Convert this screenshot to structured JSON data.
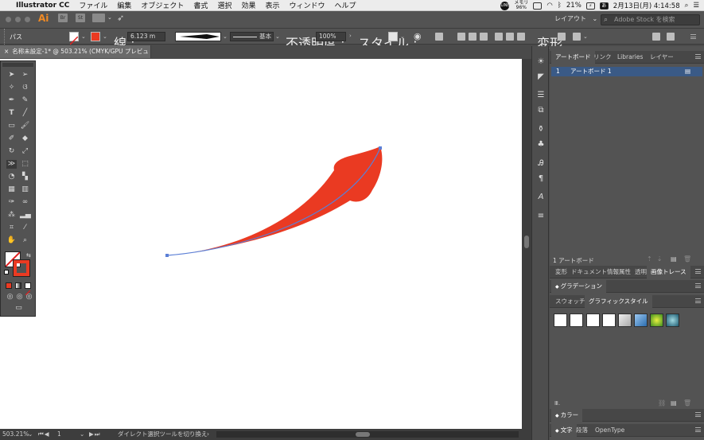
{
  "menubar": {
    "app_name": "Illustrator CC",
    "items": [
      "ファイル",
      "編集",
      "オブジェクト",
      "書式",
      "選択",
      "効果",
      "表示",
      "ウィンドウ",
      "ヘルプ"
    ],
    "ram_label": "メモリ",
    "ram_value": "96%",
    "battery": "21%",
    "date_time": "2月13日(月)  4:14:58"
  },
  "appbar": {
    "logo": "Ai",
    "br_label": "Br",
    "st_label": "St",
    "workspace": "レイアウト",
    "stock_placeholder": "Adobe Stock を検索"
  },
  "controlbar": {
    "selection_type": "パス",
    "stroke_label": "線 :",
    "stroke_weight": "6.123 m",
    "profile_label": "基本",
    "opacity_label": "不透明度 :",
    "opacity_value": "100%",
    "style_label": "スタイル :",
    "transform_label": "変形"
  },
  "document": {
    "tab_title": "名称未設定-1* @ 503.21% (CMYK/GPU プレビュー)"
  },
  "status": {
    "zoom": "503.21%",
    "artboard_num": "1",
    "tool_hint": "ダイレクト選択ツールを切り換え"
  },
  "panels": {
    "top_tabs": [
      "アートボード",
      "リンク",
      "Libraries",
      "レイヤー"
    ],
    "artboard_index": "1",
    "artboard_name": "アートボード 1",
    "artboard_count": "1 アートボード",
    "prop_tabs": [
      "変形",
      "ドキュメント情報",
      "属性",
      "透明",
      "画像トレース"
    ],
    "gradient_title": "グラデーション",
    "style_tabs": [
      "スウォッチ",
      "グラフィックスタイル"
    ],
    "color_title": "カラー",
    "text_tabs": [
      "文字",
      "段落",
      "OpenType"
    ]
  },
  "colors": {
    "shape_fill": "#ea3a22",
    "path_stroke": "#5b7fd6",
    "selection": "#3a5a86"
  }
}
